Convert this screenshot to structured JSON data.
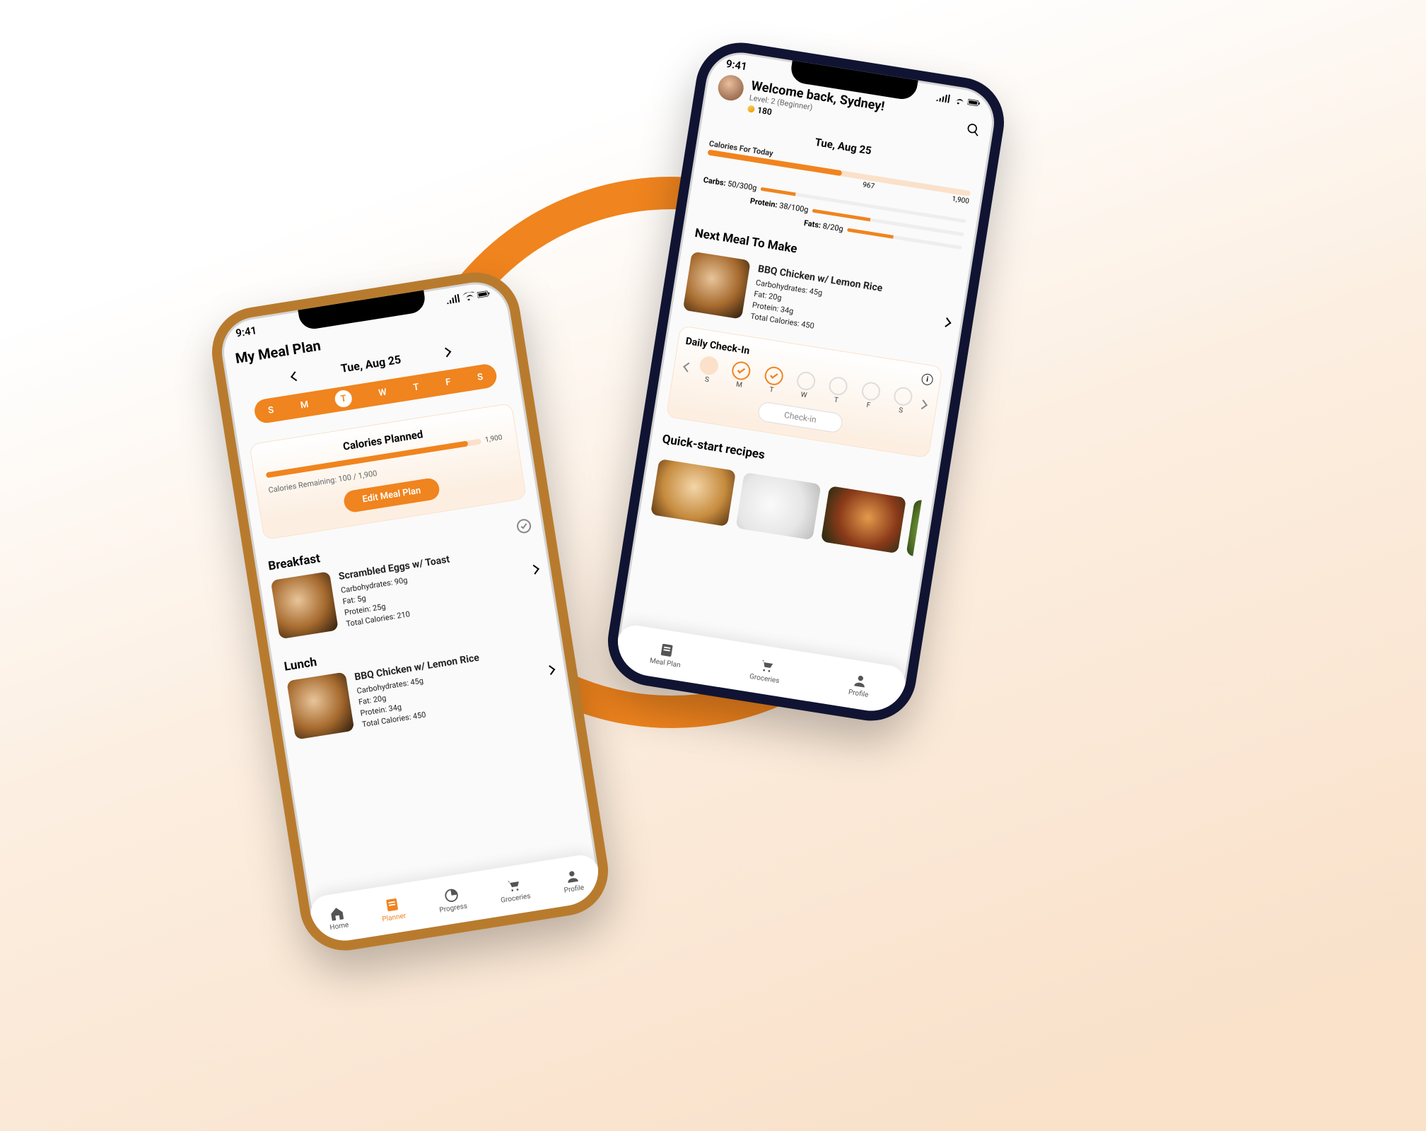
{
  "status_time": "9:41",
  "left_phone": {
    "page_title": "My Meal Plan",
    "date": "Tue, Aug 25",
    "days": [
      "S",
      "M",
      "T",
      "W",
      "T",
      "F",
      "S"
    ],
    "selected_day_index": 2,
    "calories_card": {
      "title": "Calories Planned",
      "max": "1,900",
      "remaining_label": "Calories Remaining:",
      "remaining_value": "100 / 1,900",
      "edit_button": "Edit Meal Plan"
    },
    "meals": [
      {
        "section": "Breakfast",
        "name": "Scrambled Eggs w/ Toast",
        "carbs": "Carbohydrates: 90g",
        "fat": "Fat: 5g",
        "protein": "Protein: 25g",
        "total": "Total Calories: 210"
      },
      {
        "section": "Lunch",
        "name": "BBQ Chicken w/ Lemon Rice",
        "carbs": "Carbohydrates: 45g",
        "fat": "Fat: 20g",
        "protein": "Protein: 34g",
        "total": "Total Calories: 450"
      }
    ],
    "nav": [
      "Home",
      "Planner",
      "Progress",
      "Groceries",
      "Profile"
    ]
  },
  "right_phone": {
    "welcome": "Welcome back, Sydney!",
    "level": "Level: 2 (Beginner)",
    "coins": "180",
    "date": "Tue, Aug 25",
    "calories": {
      "label": "Calories For Today",
      "current": "967",
      "goal": "1,900"
    },
    "macros": {
      "carbs": {
        "label": "Carbs:",
        "value": "50/300g"
      },
      "protein": {
        "label": "Protein:",
        "value": "38/100g"
      },
      "fats": {
        "label": "Fats:",
        "value": "8/20g"
      }
    },
    "next_meal": {
      "section": "Next Meal To Make",
      "name": "BBQ Chicken w/ Lemon Rice",
      "carbs": "Carbohydrates: 45g",
      "fat": "Fat: 20g",
      "protein": "Protein: 34g",
      "total": "Total Calories: 450"
    },
    "checkin": {
      "title": "Daily Check-In",
      "days": [
        "S",
        "M",
        "T",
        "W",
        "T",
        "F",
        "S"
      ],
      "states": [
        "filled",
        "checked",
        "checked",
        "blank",
        "blank",
        "blank",
        "blank"
      ],
      "button": "Check-in"
    },
    "quick_title": "Quick-start recipes",
    "nav": [
      "Meal Plan",
      "Groceries",
      "Profile"
    ]
  }
}
